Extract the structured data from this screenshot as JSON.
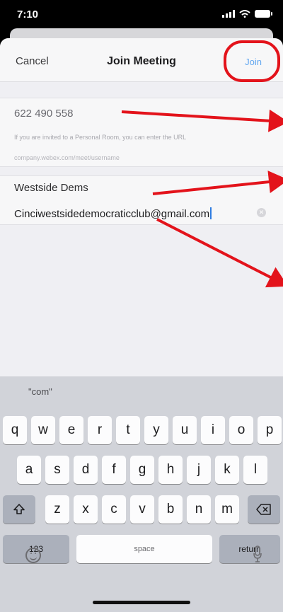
{
  "status_bar": {
    "time": "7:10"
  },
  "nav": {
    "cancel_label": "Cancel",
    "title": "Join Meeting",
    "join_label": "Join"
  },
  "meeting": {
    "number": "622 490 558",
    "hint": "If you are invited to a Personal Room, you can enter the URL",
    "hint_url": "company.webex.com/meet/username"
  },
  "user": {
    "name": "Westside Dems",
    "email": "Cinciwestsidedemocraticclub@gmail.com"
  },
  "keyboard": {
    "suggestion": "\"com\"",
    "row1": [
      "q",
      "w",
      "e",
      "r",
      "t",
      "y",
      "u",
      "i",
      "o",
      "p"
    ],
    "row2": [
      "a",
      "s",
      "d",
      "f",
      "g",
      "h",
      "j",
      "k",
      "l"
    ],
    "row3": [
      "z",
      "x",
      "c",
      "v",
      "b",
      "n",
      "m"
    ],
    "numbers_label": "123",
    "space_label": "space",
    "return_label": "return"
  },
  "colors": {
    "accent": "#62a7f0",
    "annotation": "#e3131b"
  },
  "icons": {
    "shift": "shift-icon",
    "delete": "delete-icon",
    "emoji": "emoji-icon",
    "mic": "microphone-icon",
    "clear": "clear-icon"
  }
}
